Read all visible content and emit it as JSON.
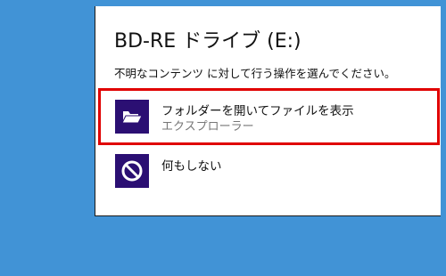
{
  "dialog": {
    "title": "BD-RE ドライブ (E:)",
    "subtitle": "不明なコンテンツ に対して行う操作を選んでください。",
    "options": [
      {
        "label": "フォルダーを開いてファイルを表示",
        "sublabel": "エクスプローラー",
        "icon": "open-folder-icon",
        "highlighted": true
      },
      {
        "label": "何もしない",
        "icon": "prohibited-icon",
        "highlighted": false
      }
    ]
  },
  "colors": {
    "desktop_background": "#4193d6",
    "dialog_background": "#ffffff",
    "tile_background": "#2b0f73",
    "highlight_border": "#e00000",
    "secondary_text": "#777777"
  }
}
